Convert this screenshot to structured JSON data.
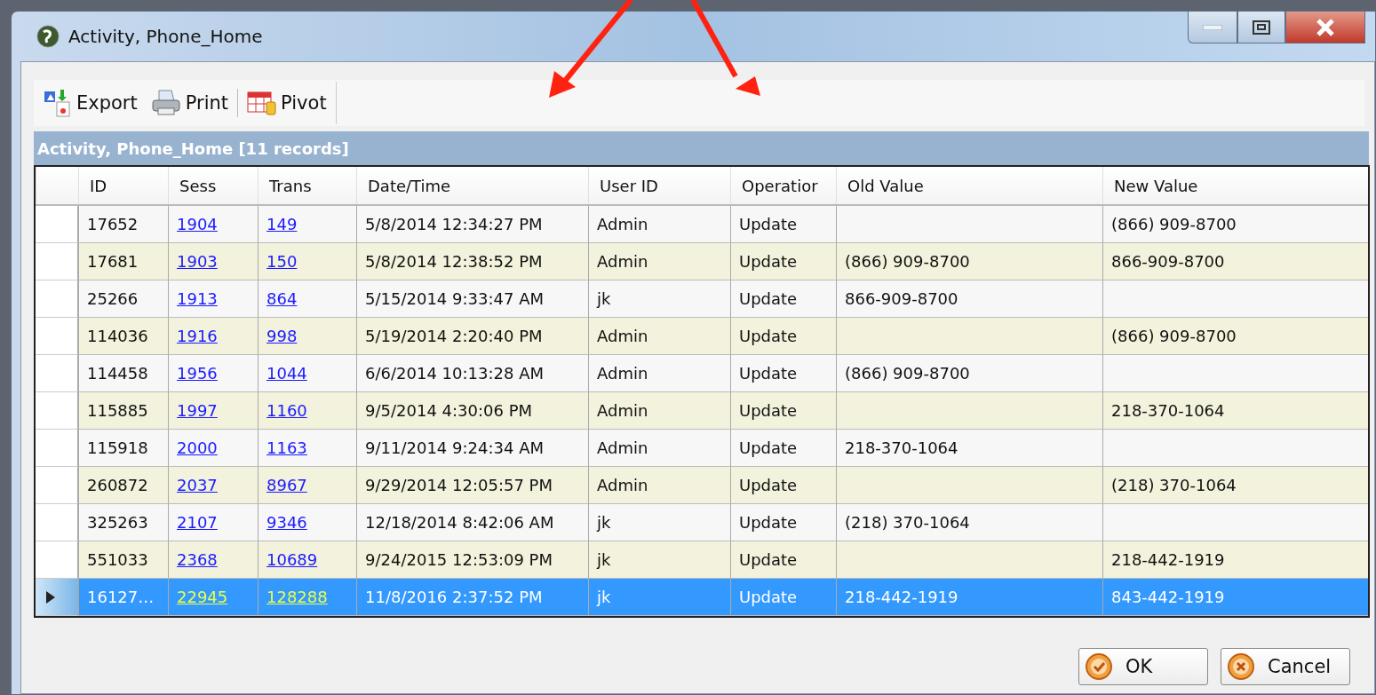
{
  "window": {
    "title": "Activity, Phone_Home"
  },
  "toolbar": [
    {
      "label": "Export",
      "kind": "export"
    },
    {
      "label": "Print",
      "kind": "print"
    },
    {
      "label": "Pivot",
      "kind": "pivot"
    }
  ],
  "grid": {
    "caption": "Activity, Phone_Home [11 records]",
    "columns": [
      "ID",
      "Sess",
      "Trans",
      "Date/Time",
      "User ID",
      "Operatior",
      "Old Value",
      "New Value"
    ],
    "rows": [
      {
        "id": "17652",
        "sess": "1904",
        "trans": "149",
        "datetime": "5/8/2014 12:34:27 PM",
        "user": "Admin",
        "operation": "Update",
        "old": "",
        "new": "(866) 909-8700",
        "selected": false
      },
      {
        "id": "17681",
        "sess": "1903",
        "trans": "150",
        "datetime": "5/8/2014 12:38:52 PM",
        "user": "Admin",
        "operation": "Update",
        "old": "(866) 909-8700",
        "new": "866-909-8700",
        "selected": false
      },
      {
        "id": "25266",
        "sess": "1913",
        "trans": "864",
        "datetime": "5/15/2014 9:33:47 AM",
        "user": "jk",
        "operation": "Update",
        "old": "866-909-8700",
        "new": "",
        "selected": false
      },
      {
        "id": "114036",
        "sess": "1916",
        "trans": "998",
        "datetime": "5/19/2014 2:20:40 PM",
        "user": "Admin",
        "operation": "Update",
        "old": "",
        "new": "(866) 909-8700",
        "selected": false
      },
      {
        "id": "114458",
        "sess": "1956",
        "trans": "1044",
        "datetime": "6/6/2014 10:13:28 AM",
        "user": "Admin",
        "operation": "Update",
        "old": "(866) 909-8700",
        "new": "",
        "selected": false
      },
      {
        "id": "115885",
        "sess": "1997",
        "trans": "1160",
        "datetime": "9/5/2014 4:30:06 PM",
        "user": "Admin",
        "operation": "Update",
        "old": "",
        "new": "218-370-1064",
        "selected": false
      },
      {
        "id": "115918",
        "sess": "2000",
        "trans": "1163",
        "datetime": "9/11/2014 9:24:34 AM",
        "user": "Admin",
        "operation": "Update",
        "old": "218-370-1064",
        "new": "",
        "selected": false
      },
      {
        "id": "260872",
        "sess": "2037",
        "trans": "8967",
        "datetime": "9/29/2014 12:05:57 PM",
        "user": "Admin",
        "operation": "Update",
        "old": "",
        "new": "(218) 370-1064",
        "selected": false
      },
      {
        "id": "325263",
        "sess": "2107",
        "trans": "9346",
        "datetime": "12/18/2014 8:42:06 AM",
        "user": "jk",
        "operation": "Update",
        "old": "(218) 370-1064",
        "new": "",
        "selected": false
      },
      {
        "id": "551033",
        "sess": "2368",
        "trans": "10689",
        "datetime": "9/24/2015 12:53:09 PM",
        "user": "jk",
        "operation": "Update",
        "old": "",
        "new": "218-442-1919",
        "selected": false
      },
      {
        "id": "16127…",
        "sess": "22945",
        "trans": "128288",
        "datetime": "11/8/2016 2:37:52 PM",
        "user": "jk",
        "operation": "Update",
        "old": "218-442-1919",
        "new": "843-442-1919",
        "selected": true
      }
    ]
  },
  "buttons": [
    {
      "label": "OK",
      "kind": "ok"
    },
    {
      "label": "Cancel",
      "kind": "cancel"
    }
  ]
}
